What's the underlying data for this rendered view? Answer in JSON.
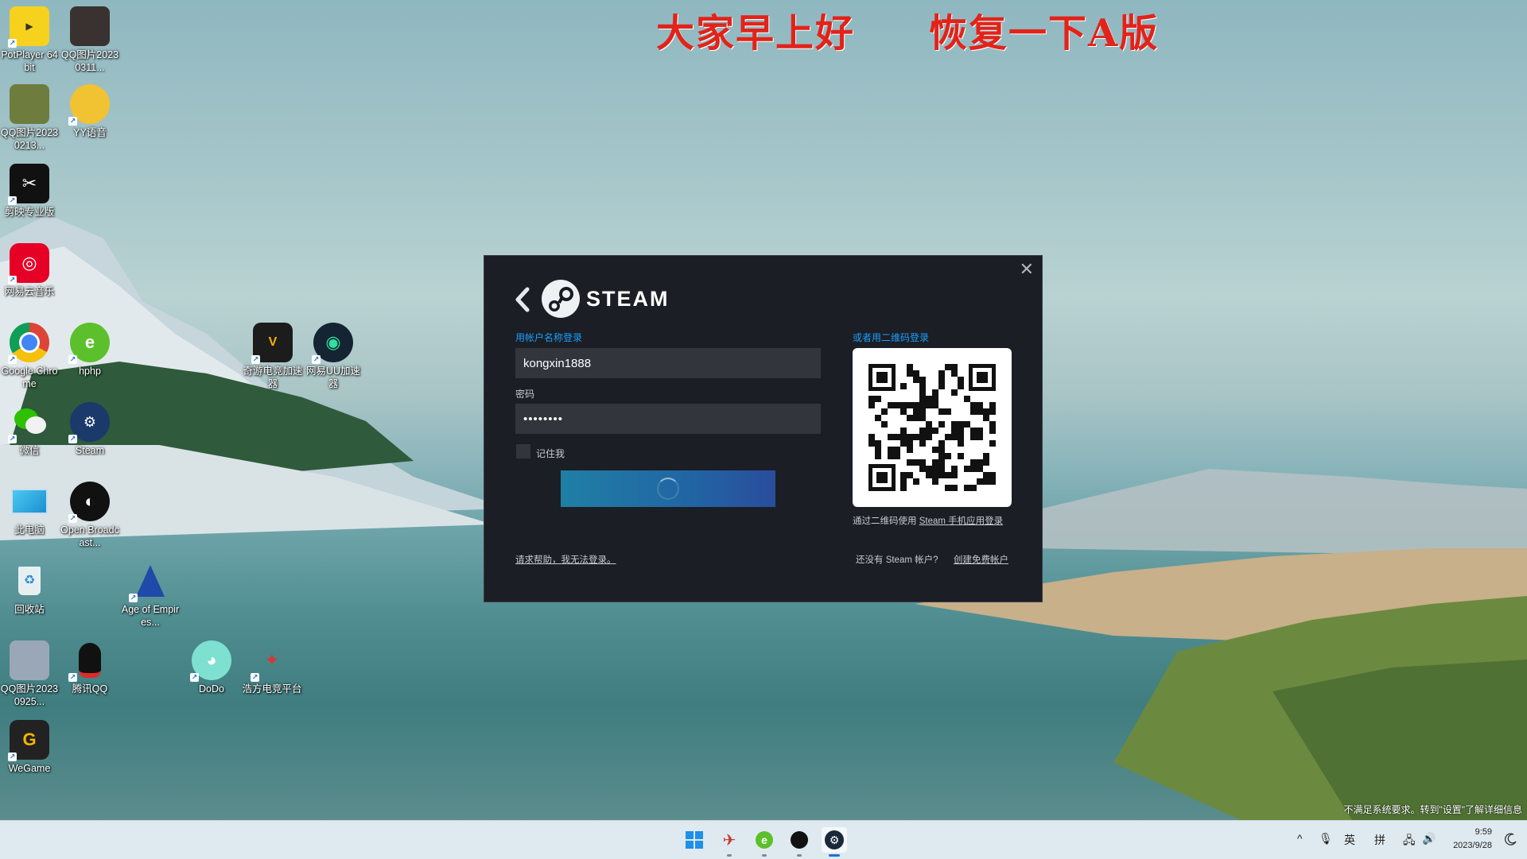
{
  "overlay": {
    "left_text": "大家早上好",
    "right_text": "恢复一下A版"
  },
  "desktop_icons": [
    {
      "label": "PotPlayer 64 bit"
    },
    {
      "label": "QQ图片20230311..."
    },
    {
      "label": "QQ图片20230213..."
    },
    {
      "label": "YY语音"
    },
    {
      "label": "剪映专业版"
    },
    {
      "label": "网易云音乐"
    },
    {
      "label": "Google Chrome"
    },
    {
      "label": "hphp"
    },
    {
      "label": "奇游电竞加速器"
    },
    {
      "label": "网易UU加速器"
    },
    {
      "label": "微信"
    },
    {
      "label": "Steam"
    },
    {
      "label": "此电脑"
    },
    {
      "label": "Open Broadcast..."
    },
    {
      "label": "回收站"
    },
    {
      "label": "Age of Empires..."
    },
    {
      "label": "QQ图片20230925..."
    },
    {
      "label": "腾讯QQ"
    },
    {
      "label": "DoDo"
    },
    {
      "label": "浩方电竞平台"
    },
    {
      "label": "WeGame"
    }
  ],
  "dialog": {
    "brand": "STEAM",
    "close_glyph": "✕",
    "account_label": "用帐户名称登录",
    "account_value": "kongxin1888",
    "password_label": "密码",
    "password_value": "••••••••",
    "remember_label": "记住我",
    "qr_label": "或者用二维码登录",
    "qr_caption_prefix": "通过二维码使用",
    "qr_caption_link": "Steam 手机应用登录",
    "help_link": "请求帮助，我无法登录。",
    "no_account": "还没有 Steam 帐户?",
    "create_account": "创建免费帐户"
  },
  "activation_notice": "不满足系统要求。转到\"设置\"了解详细信息",
  "taskbar": {
    "apps": [
      "windows-start-icon",
      "qiyou-icon",
      "hphp-icon",
      "obs-icon",
      "steam-icon"
    ],
    "tray": {
      "chevron": "^",
      "mic": "🎙",
      "lang": "英",
      "ime": "拼",
      "network": "🖧",
      "volume": "🔊"
    },
    "time": "9:59",
    "date": "2023/9/28"
  },
  "colors": {
    "accent": "#1a9fff",
    "dialog_bg": "#1b1e24",
    "overlay_text": "#e2231a"
  }
}
